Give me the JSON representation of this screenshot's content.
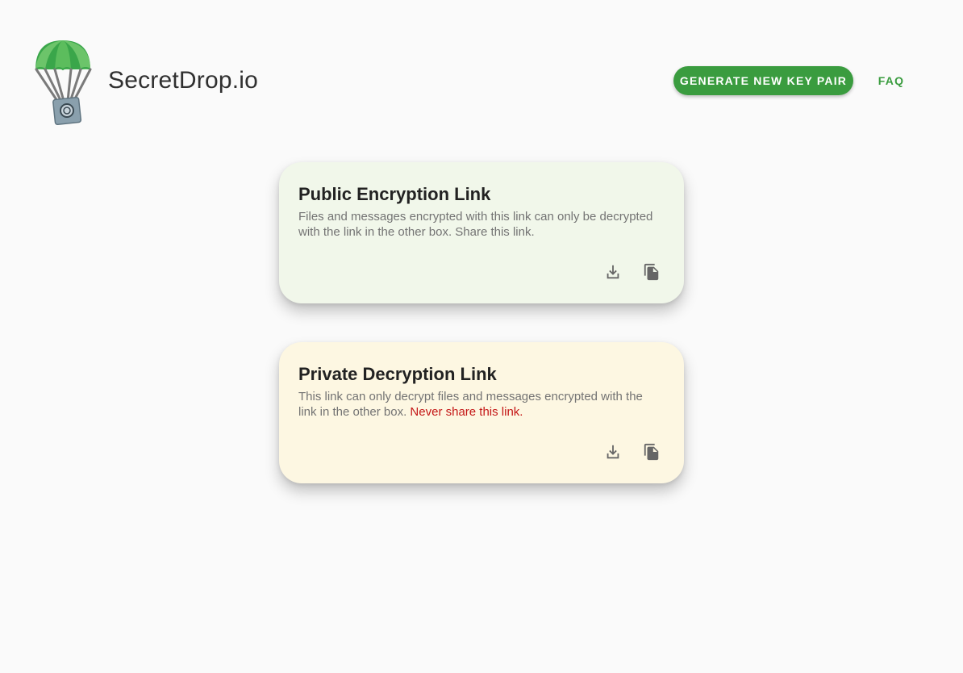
{
  "header": {
    "brand": "SecretDrop.io",
    "generate_button": "GENERATE NEW KEY PAIR",
    "faq_link": "FAQ"
  },
  "cards": {
    "public": {
      "title": "Public Encryption Link",
      "description": "Files and messages encrypted with this link can only be decrypted with the link in the other box. Share this link.",
      "actions": [
        "download-icon",
        "copy-icon"
      ]
    },
    "private": {
      "title": "Private Decryption Link",
      "description": "This link can only decrypt files and messages encrypted with the link in the other box.",
      "warning": "Never share this link.",
      "actions": [
        "download-icon",
        "copy-icon"
      ]
    }
  },
  "colors": {
    "accent": "#3a9c3f",
    "public_card_bg": "#f1f7ea",
    "private_card_bg": "#fdf7e2",
    "warning": "#c41616",
    "background": "#fafafa"
  }
}
